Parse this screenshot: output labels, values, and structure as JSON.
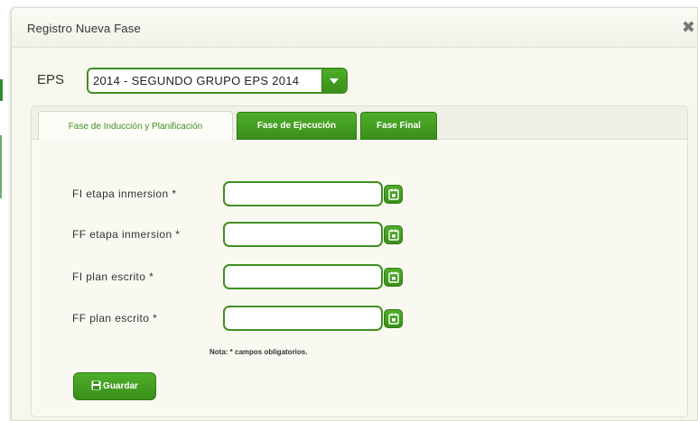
{
  "dialog": {
    "title": "Registro Nueva Fase",
    "close_icon": "close-icon"
  },
  "eps": {
    "label": "EPS",
    "selected": "2014 - SEGUNDO GRUPO EPS 2014"
  },
  "tabs": [
    {
      "label": "Fase de Inducción y Planificación",
      "active": true
    },
    {
      "label": "Fase de Ejecución",
      "active": false
    },
    {
      "label": "Fase Final",
      "active": false
    }
  ],
  "form": {
    "fields": [
      {
        "label": "FI etapa inmersion *",
        "value": ""
      },
      {
        "label": "FF etapa inmersion *",
        "value": ""
      },
      {
        "label": "FI plan escrito *",
        "value": ""
      },
      {
        "label": "FF plan escrito *",
        "value": ""
      }
    ],
    "note": "Nota: * campos obligatorios.",
    "save_label": "Guardar"
  },
  "colors": {
    "accent": "#3f8f1f",
    "background": "#f7f7ee"
  }
}
